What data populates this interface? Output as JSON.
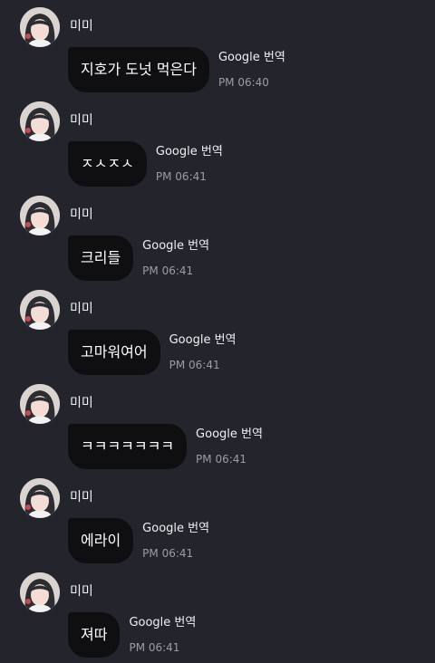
{
  "colors": {
    "background": "#24252c",
    "bubble": "#0f0f11",
    "time_text": "#9a9ca6"
  },
  "messages": [
    {
      "sender": "미미",
      "text": "지호가 도넛 먹은다",
      "translate_label": "Google 번역",
      "time": "PM 06:40"
    },
    {
      "sender": "미미",
      "text": "ㅈㅅㅈㅅ",
      "translate_label": "Google 번역",
      "time": "PM 06:41"
    },
    {
      "sender": "미미",
      "text": "크리들",
      "translate_label": "Google 번역",
      "time": "PM 06:41"
    },
    {
      "sender": "미미",
      "text": "고마워여어",
      "translate_label": "Google 번역",
      "time": "PM 06:41"
    },
    {
      "sender": "미미",
      "text": "ㅋㅋㅋㅋㅋㅋㅋ",
      "translate_label": "Google 번역",
      "time": "PM 06:41"
    },
    {
      "sender": "미미",
      "text": "에라이",
      "translate_label": "Google 번역",
      "time": "PM 06:41"
    },
    {
      "sender": "미미",
      "text": "져따",
      "translate_label": "Google 번역",
      "time": "PM 06:41"
    }
  ]
}
